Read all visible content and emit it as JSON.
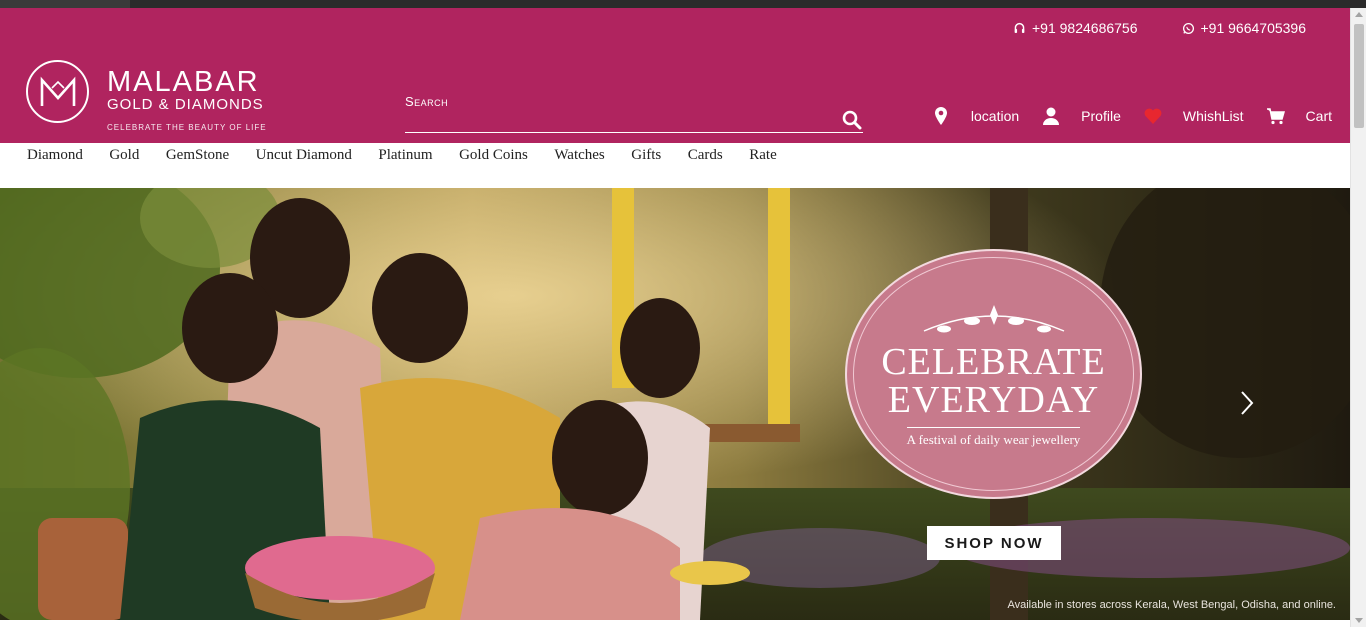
{
  "header": {
    "phone_support": "+91 9824686756",
    "phone_whatsapp": "+91 9664705396",
    "brand_name": "MALABAR",
    "brand_sub": "GOLD & DIAMONDS",
    "brand_tagline": "CELEBRATE THE BEAUTY OF LIFE",
    "search_placeholder": "Search",
    "actions": {
      "location": "location",
      "profile": "Profile",
      "wishlist": "WhishList",
      "cart": "Cart"
    }
  },
  "menu": [
    "Diamond",
    "Gold",
    "GemStone",
    "Uncut Diamond",
    "Platinum",
    "Gold Coins",
    "Watches",
    "Gifts",
    "Cards",
    "Rate"
  ],
  "hero": {
    "badge_line1": "CELEBRATE",
    "badge_line2": "EVERYDAY",
    "badge_sub": "A festival of daily wear jewellery",
    "cta": "SHOP NOW",
    "availability": "Available in stores across Kerala, West Bengal, Odisha, and online."
  },
  "colors": {
    "brand": "#b0245f",
    "badge": "#c77a8c",
    "wishlist_heart": "#e8272f"
  },
  "icons": [
    "headset-icon",
    "whatsapp-icon",
    "search-icon",
    "location-pin-icon",
    "user-icon",
    "heart-icon",
    "cart-icon",
    "chevron-right-icon"
  ]
}
